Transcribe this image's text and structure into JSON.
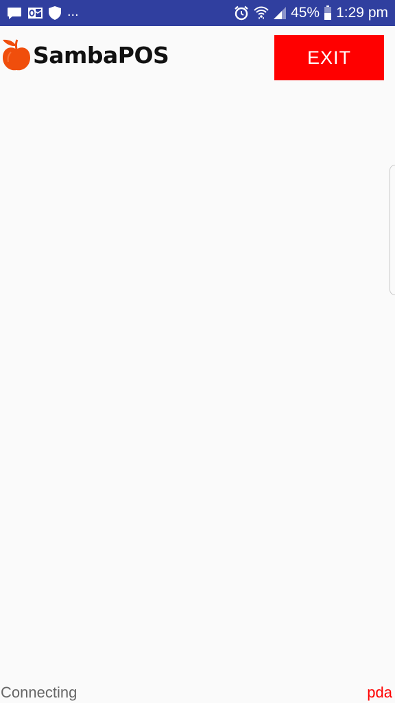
{
  "status_bar": {
    "left_icons": [
      "message-icon",
      "outlook-icon",
      "shield-icon"
    ],
    "overflow": "...",
    "right_icons": [
      "alarm-icon",
      "wifi-icon",
      "signal-icon",
      "battery-icon"
    ],
    "battery_percent": "45%",
    "time": "1:29 pm",
    "background_color": "#303f9f"
  },
  "header": {
    "logo_text": "SambaPOS",
    "logo_icon": "apple-logo-icon",
    "exit_label": "EXIT",
    "exit_color": "#ff0000"
  },
  "footer": {
    "status_text": "Connecting",
    "terminal_label": "pda",
    "terminal_color": "#ff0000"
  }
}
